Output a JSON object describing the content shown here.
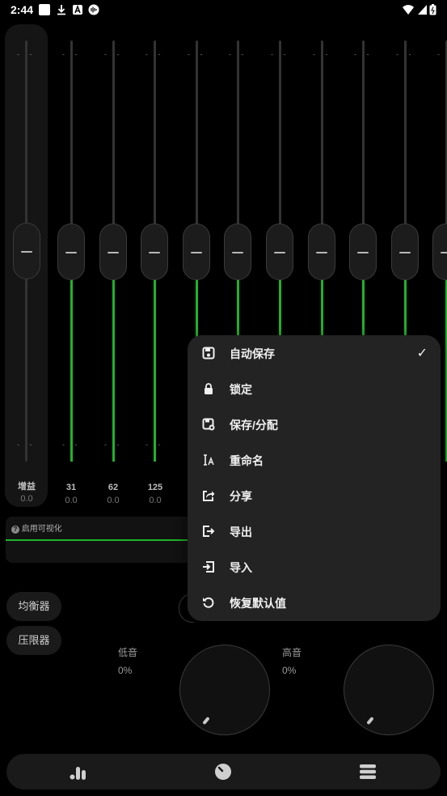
{
  "status_bar": {
    "time": "2:44"
  },
  "gain": {
    "label": "增益",
    "value": "0.0"
  },
  "bands": [
    {
      "label": "31",
      "value": "0.0"
    },
    {
      "label": "62",
      "value": "0.0"
    },
    {
      "label": "125",
      "value": "0.0"
    }
  ],
  "visualizer": {
    "label": "启用可视化"
  },
  "buttons": {
    "equalizer": "均衡器",
    "limiter": "压限器"
  },
  "dials": {
    "bass": {
      "label": "低音",
      "value": "0%"
    },
    "treble": {
      "label": "高音",
      "value": "0%"
    }
  },
  "menu": {
    "items": [
      {
        "label": "自动保存",
        "icon": "save-icon",
        "checked": true
      },
      {
        "label": "锁定",
        "icon": "lock-icon"
      },
      {
        "label": "保存/分配",
        "icon": "save-assign-icon"
      },
      {
        "label": "重命名",
        "icon": "rename-icon"
      },
      {
        "label": "分享",
        "icon": "share-icon"
      },
      {
        "label": "导出",
        "icon": "export-icon"
      },
      {
        "label": "导入",
        "icon": "import-icon"
      },
      {
        "label": "恢复默认值",
        "icon": "restore-icon"
      }
    ],
    "check_glyph": "✓"
  },
  "colors": {
    "accent": "#1fb32a",
    "menu_bg": "#232323",
    "background": "#000000"
  },
  "bottom_nav": {
    "items": [
      "equalizer-bars-icon",
      "dial-icon",
      "menu-stack-icon"
    ]
  }
}
